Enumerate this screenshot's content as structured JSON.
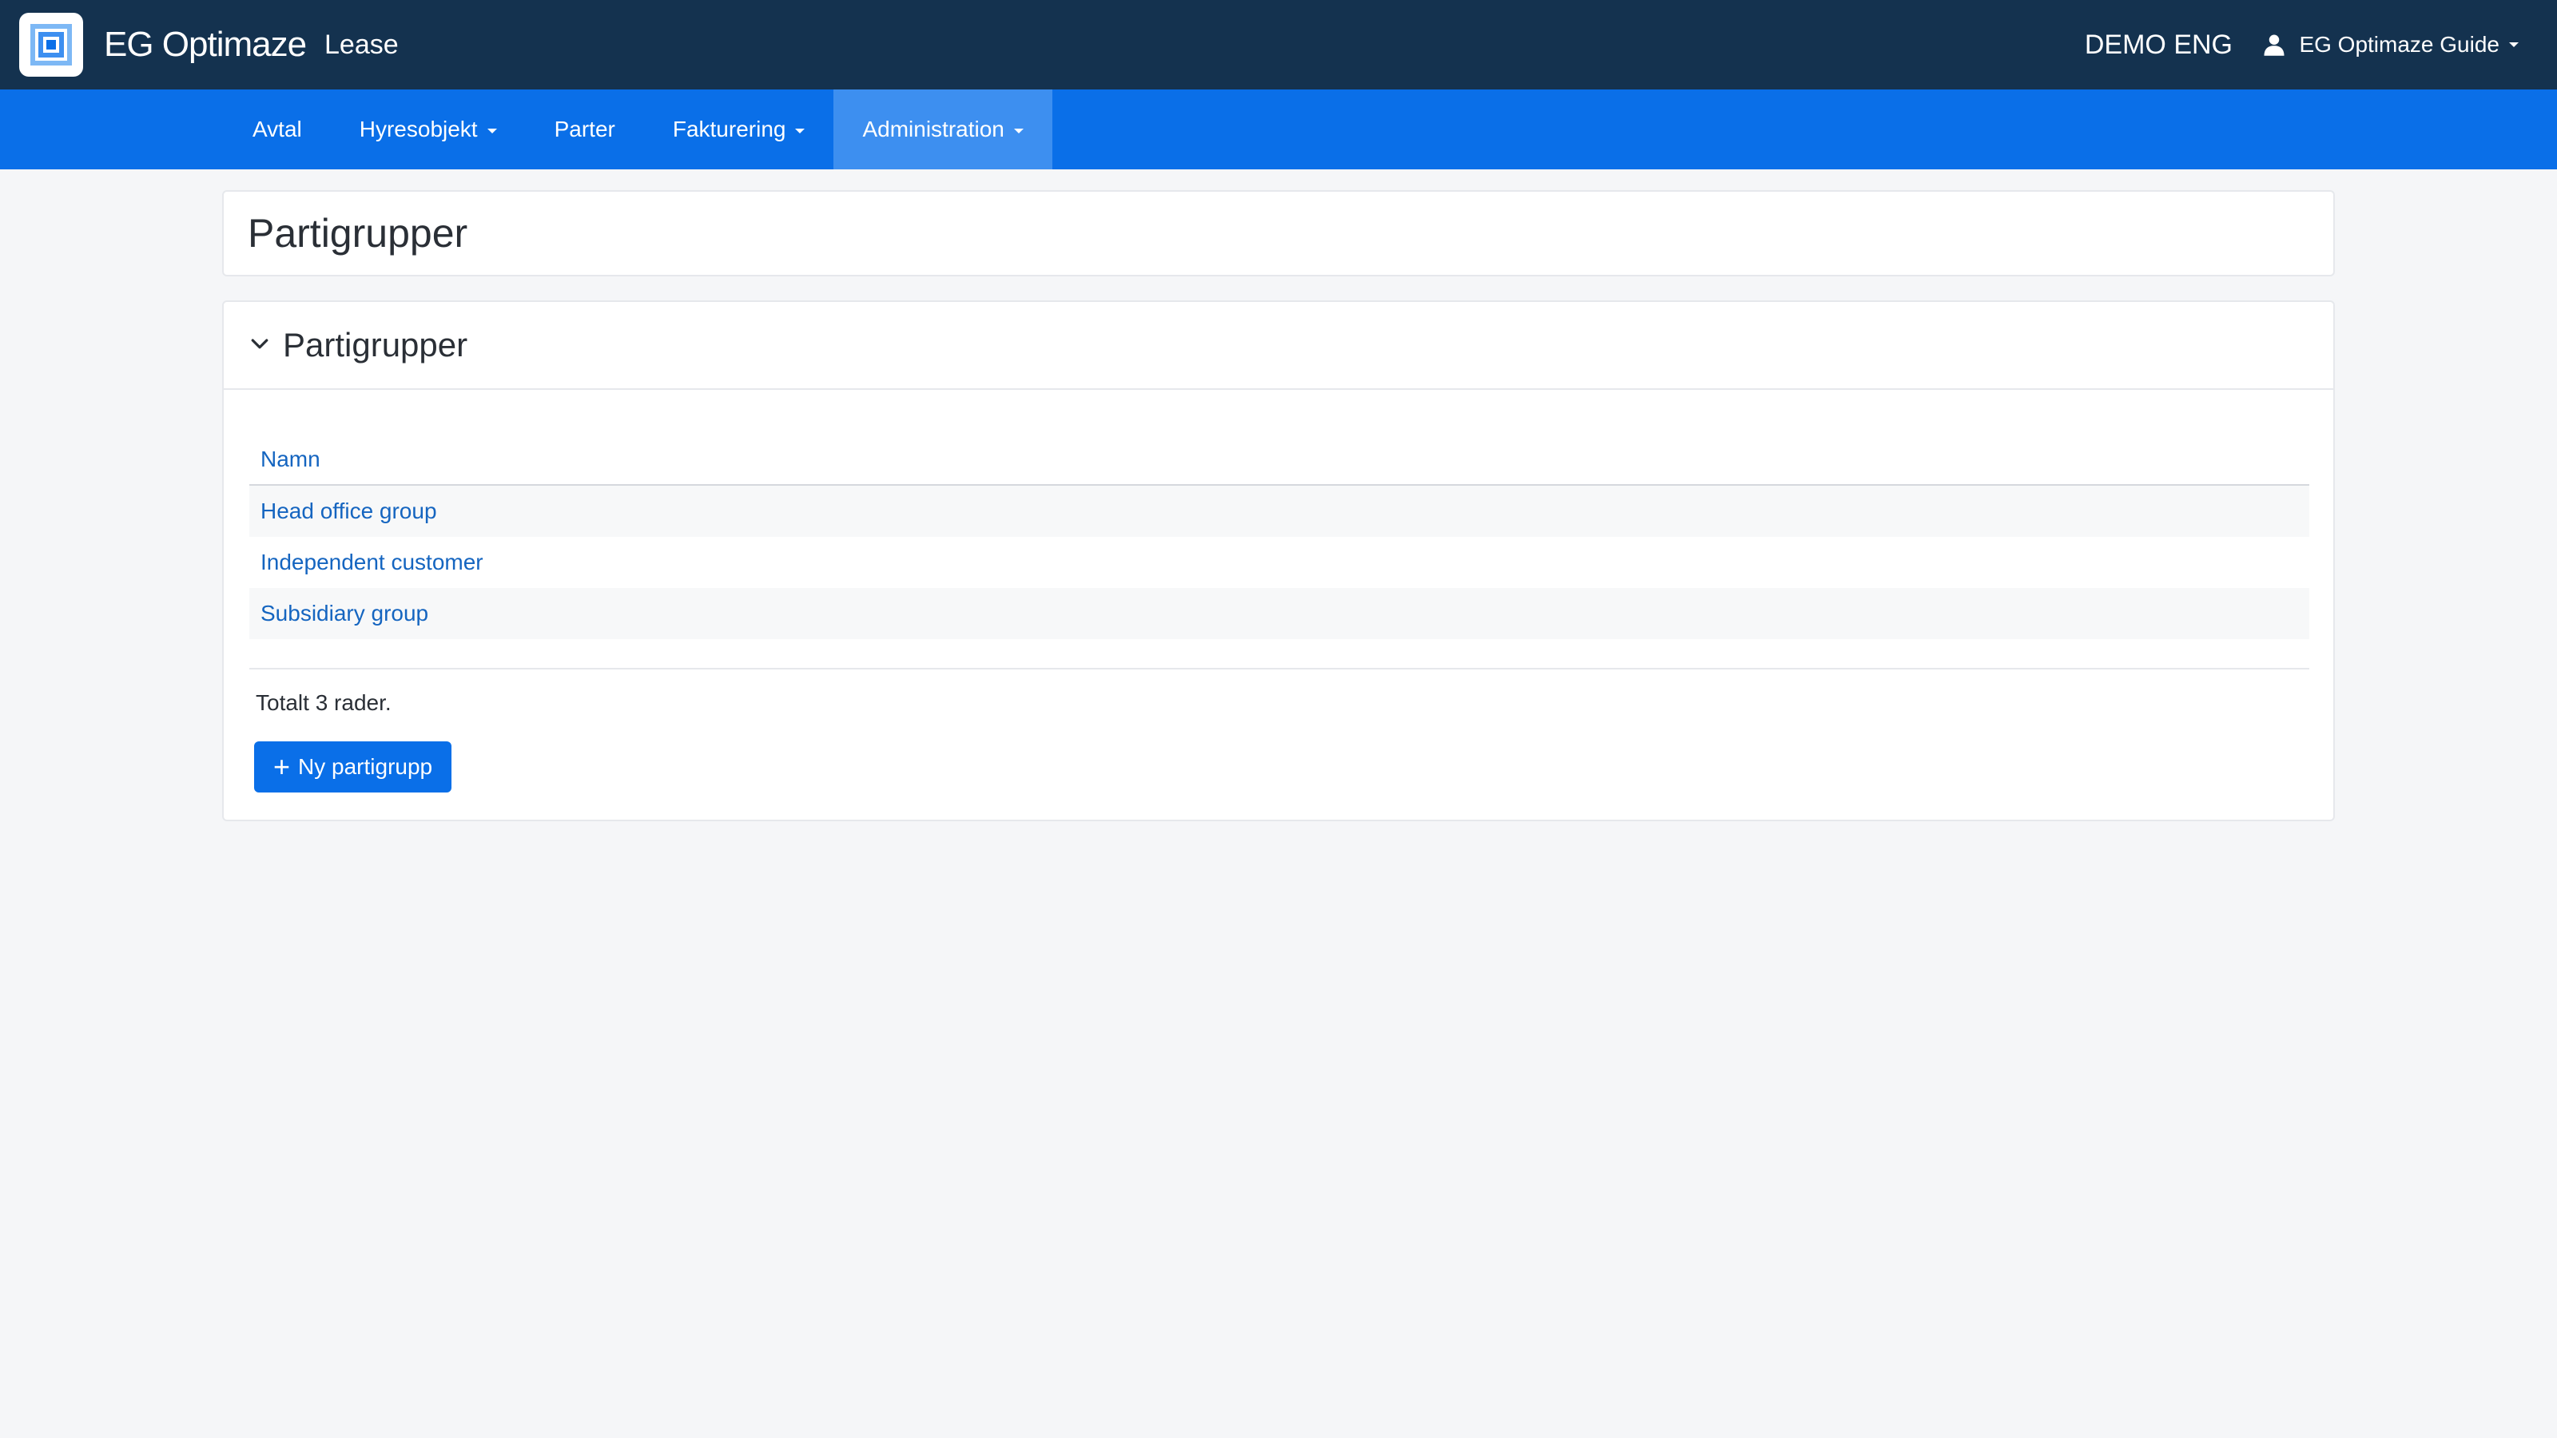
{
  "header": {
    "app_name": "EG Optimaze",
    "module": "Lease",
    "tenant": "DEMO ENG",
    "user": "EG Optimaze Guide"
  },
  "nav": {
    "items": [
      {
        "label": "Avtal",
        "dropdown": false
      },
      {
        "label": "Hyresobjekt",
        "dropdown": true
      },
      {
        "label": "Parter",
        "dropdown": false
      },
      {
        "label": "Fakturering",
        "dropdown": true
      },
      {
        "label": "Administration",
        "dropdown": true,
        "active": true
      }
    ]
  },
  "page": {
    "title": "Partigrupper"
  },
  "section": {
    "title": "Partigrupper",
    "table": {
      "column": "Namn",
      "rows": [
        "Head office group",
        "Independent customer",
        "Subsidiary group"
      ]
    },
    "total": "Totalt 3 rader.",
    "new_button": "Ny partigrupp",
    "new_button_icon": "+"
  },
  "colors": {
    "topbar": "#14324f",
    "navbar": "#0a6fe8",
    "nav_active": "#3d8ff0",
    "link": "#1565c0"
  }
}
